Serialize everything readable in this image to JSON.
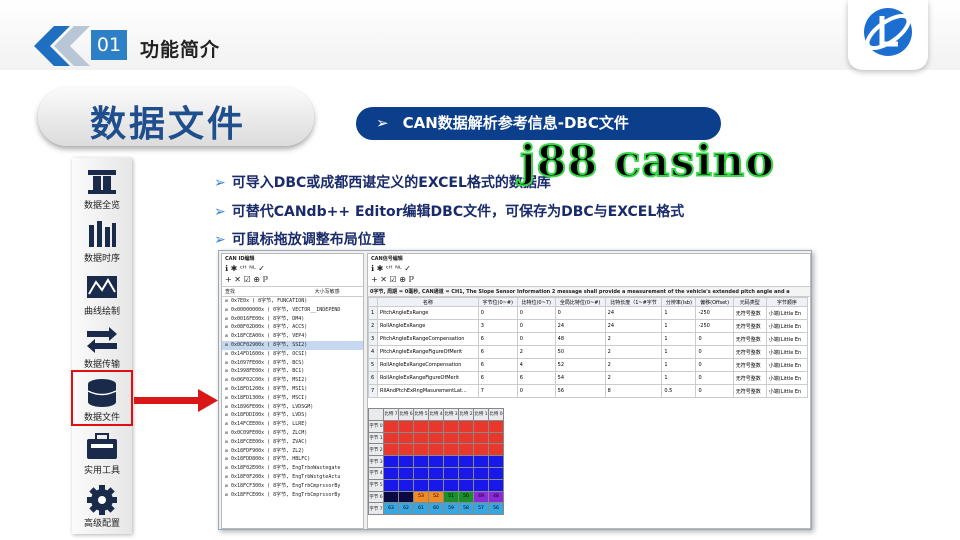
{
  "header": {
    "section_number": "01",
    "section_title": "功能简介"
  },
  "page_title": "数据文件",
  "subtitle": {
    "arrow": "➢",
    "text": "CAN数据解析参考信息-DBC文件"
  },
  "watermark": "j88 casino",
  "bullets": [
    "可导入DBC或成都西谌定义的EXCEL格式的数据库",
    "可替代CANdb++ Editor编辑DBC文件，可保存为DBC与EXCEL格式",
    "可鼠标拖放调整布局位置"
  ],
  "bullet_glyph": "➢",
  "sidebar": [
    {
      "label": "数据全览",
      "icon": "overview-icon"
    },
    {
      "label": "数据时序",
      "icon": "timing-icon"
    },
    {
      "label": "曲线绘制",
      "icon": "curve-icon"
    },
    {
      "label": "数据传输",
      "icon": "transfer-icon"
    },
    {
      "label": "数据文件",
      "icon": "database-icon",
      "selected": true
    },
    {
      "label": "实用工具",
      "icon": "toolbox-icon"
    },
    {
      "label": "高级配置",
      "icon": "gear-icon"
    }
  ],
  "screenshot": {
    "left_title": "CAN ID编辑",
    "right_title": "CAN信号编辑",
    "toolbar_glyphs": "ℹ ✱ ᶜᴴ ᴺᴸ ✓\n+ ✕ ☑ ⊕ ℙ",
    "search_label": "查找",
    "search_value": "大小写敏感",
    "message_text": "0字节, 周期 = 0毫秒, CAN通道 = CH1, The Slope Sensor Information 2 message shall provide a measurement of the vehicle's extended pitch angle and a",
    "tree": [
      "0x7E0x ( 8字节, FUNCATION)",
      "0x00000000x ( 0字节, VECTOR__INDEPEND",
      "0x0016FE00x ( 8字节, DM4)",
      "0x08F02D00x ( 8字节, ACC5)",
      "0x18FCEA00x ( 8字节, VEP4)",
      "0x0CF02900x ( 8字节, SSI2)",
      "0x14FD1600x ( 8字节, OCSI)",
      "0x1097FE00x ( 8字节, BCS)",
      "0x1998FE00x ( 8字节, BC1)",
      "0x06F02C00x ( 8字节, MSI2)",
      "0x18FD1200x ( 8字节, MSI1)",
      "0x18FD1300x ( 8字节, MSCI)",
      "0x1896FE00x ( 8字节, LVDSGM)",
      "0x18FDDI00x ( 8字节, LVDS)",
      "0x14FCEE00x ( 8字节, LLRE)",
      "0x0C09FE00x ( 8字节, ZLCM)",
      "0x18FCEE00x ( 8字节, ZVAC)",
      "0x18FDF900x ( 8字节, ZL2)",
      "0x18FDD800x ( 8字节, HBLFC)",
      "0x18F02E00x ( 8字节, EngTrboWastegate",
      "0x18F0F200x ( 8字节, EngTrbWstgteActu",
      "0x18FCF300x ( 8字节, EngTrbCmprssorBy",
      "0x18FFCE00x ( 8字节, EngTrbCmprssorBy"
    ],
    "selected_tree_index": 5,
    "columns": [
      "",
      "名称",
      "字节位(0~#)",
      "比特位(0~7)",
      "全局比特位(0~#)",
      "比特长度（1~#字节",
      "分辨率(lsb)",
      "偏移(Offset)",
      "元码类型",
      "字节顺序"
    ],
    "rows": [
      [
        "1",
        "PitchAngleExRange",
        "0",
        "0",
        "0",
        "24",
        "1",
        "-250",
        "无符号整数",
        "小端(Little En"
      ],
      [
        "2",
        "RollAngleExRange",
        "3",
        "0",
        "24",
        "24",
        "1",
        "-250",
        "无符号整数",
        "小端(Little En"
      ],
      [
        "3",
        "PitchAngleExRangeCompensation",
        "6",
        "0",
        "48",
        "2",
        "1",
        "0",
        "无符号整数",
        "小端(Little En"
      ],
      [
        "4",
        "PitchAngleExRangeFigureOfMerit",
        "6",
        "2",
        "50",
        "2",
        "1",
        "0",
        "无符号整数",
        "小端(Little En"
      ],
      [
        "5",
        "RollAngleExRangeCompensation",
        "6",
        "4",
        "52",
        "2",
        "1",
        "0",
        "无符号整数",
        "小端(Little En"
      ],
      [
        "6",
        "RollAngleExRangeFigureOfMerit",
        "6",
        "6",
        "54",
        "2",
        "1",
        "0",
        "无符号整数",
        "小端(Little En"
      ],
      [
        "7",
        "RllAndPtchExRngMasurementLat...",
        "7",
        "0",
        "56",
        "8",
        "0.5",
        "0",
        "无符号整数",
        "小端(Little En"
      ]
    ],
    "bit_header": [
      "比特 7",
      "比特 6",
      "比特 5",
      "比特 4",
      "比特 3",
      "比特 2",
      "比特 1",
      "比特 0"
    ],
    "byte_rows": [
      {
        "label": "字节 0",
        "cells": [
          "",
          "",
          "",
          "",
          "",
          "",
          "",
          ""
        ],
        "color": "#e8372c"
      },
      {
        "label": "字节 1",
        "cells": [
          "",
          "",
          "",
          "",
          "",
          "",
          "",
          ""
        ],
        "color": "#e8372c"
      },
      {
        "label": "字节 2",
        "cells": [
          "",
          "",
          "",
          "",
          "",
          "",
          "",
          ""
        ],
        "color": "#e8372c"
      },
      {
        "label": "字节 3",
        "cells": [
          "",
          "",
          "",
          "",
          "",
          "",
          "",
          ""
        ],
        "color": "#1818e8"
      },
      {
        "label": "字节 4",
        "cells": [
          "",
          "",
          "",
          "",
          "",
          "",
          "",
          ""
        ],
        "color": "#1818e8"
      },
      {
        "label": "字节 5",
        "cells": [
          "",
          "",
          "",
          "",
          "",
          "",
          "",
          ""
        ],
        "color": "#1818e8"
      },
      {
        "label": "字节 6",
        "cells": [
          "",
          "",
          "53",
          "52",
          "51",
          "50",
          "49",
          "48"
        ],
        "colors": [
          "#0a0a40",
          "#0a0a40",
          "#f08a24",
          "#f08a24",
          "#1a8f2a",
          "#1a8f2a",
          "#8a2ad8",
          "#8a2ad8"
        ]
      },
      {
        "label": "字节 7",
        "cells": [
          "63",
          "62",
          "61",
          "60",
          "59",
          "58",
          "57",
          "56"
        ],
        "color": "#3aa6e0"
      }
    ]
  },
  "colors": {
    "accent": "#2d7fc6",
    "title_blue": "#1e4e8c",
    "navy": "#0b3f8b",
    "highlight": "#e01010"
  }
}
